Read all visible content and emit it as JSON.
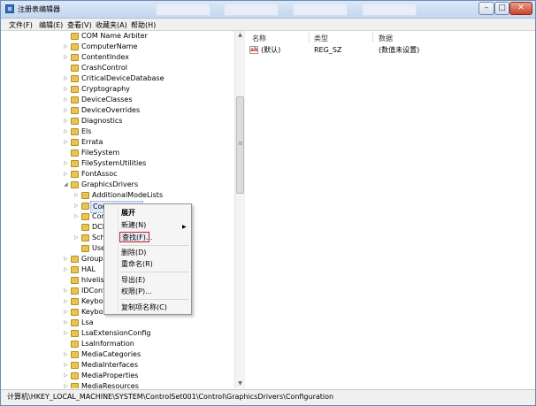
{
  "window": {
    "title": "注册表编辑器",
    "controls": {
      "minimize": "–",
      "maximize": "□",
      "close": "✕"
    }
  },
  "menubar": [
    "文件(F)",
    "编辑(E)",
    "查看(V)",
    "收藏夹(A)",
    "帮助(H)"
  ],
  "tree": {
    "items": [
      {
        "label": "COM Name Arbiter",
        "expander": ""
      },
      {
        "label": "ComputerName",
        "expander": "▷"
      },
      {
        "label": "ContentIndex",
        "expander": "▷"
      },
      {
        "label": "CrashControl",
        "expander": ""
      },
      {
        "label": "CriticalDeviceDatabase",
        "expander": "▷"
      },
      {
        "label": "Cryptography",
        "expander": "▷"
      },
      {
        "label": "DeviceClasses",
        "expander": "▷"
      },
      {
        "label": "DeviceOverrides",
        "expander": "▷"
      },
      {
        "label": "Diagnostics",
        "expander": "▷"
      },
      {
        "label": "Els",
        "expander": "▷"
      },
      {
        "label": "Errata",
        "expander": "▷"
      },
      {
        "label": "FileSystem",
        "expander": ""
      },
      {
        "label": "FileSystemUtilities",
        "expander": "▷"
      },
      {
        "label": "FontAssoc",
        "expander": "▷"
      },
      {
        "label": "GraphicsDrivers",
        "expander": "◢"
      },
      {
        "label": "AdditionalModeLists",
        "expander": "▷"
      },
      {
        "label": "Configuration",
        "expander": "▷"
      },
      {
        "label": "Con",
        "expander": "▷"
      },
      {
        "label": "DCI",
        "expander": ""
      },
      {
        "label": "Sch",
        "expander": "▷"
      },
      {
        "label": "Use",
        "expander": ""
      },
      {
        "label": "Group",
        "expander": "▷"
      },
      {
        "label": "HAL",
        "expander": "▷"
      },
      {
        "label": "hivelist",
        "expander": ""
      },
      {
        "label": "IDConf",
        "expander": "▷"
      },
      {
        "label": "Keybo",
        "expander": "▷"
      },
      {
        "label": "Keybo",
        "expander": "▷"
      },
      {
        "label": "Lsa",
        "expander": "▷"
      },
      {
        "label": "LsaExtensionConfig",
        "expander": "▷"
      },
      {
        "label": "LsaInformation",
        "expander": ""
      },
      {
        "label": "MediaCategories",
        "expander": "▷"
      },
      {
        "label": "MediaInterfaces",
        "expander": "▷"
      },
      {
        "label": "MediaProperties",
        "expander": "▷"
      },
      {
        "label": "MediaResources",
        "expander": "▷"
      }
    ]
  },
  "values": {
    "headers": {
      "name": "名称",
      "type": "类型",
      "data": "数据"
    },
    "rows": [
      {
        "icon": "ab",
        "name": "(默认)",
        "type": "REG_SZ",
        "data": "(数值未设置)"
      }
    ]
  },
  "context_menu": {
    "items": [
      {
        "label": "展开"
      },
      {
        "label": "新建(N)",
        "arrow": "▶"
      },
      {
        "label": "查找(F)..."
      },
      {
        "label": "删除(D)"
      },
      {
        "label": "重命名(R)"
      },
      {
        "label": "导出(E)"
      },
      {
        "label": "权限(P)..."
      },
      {
        "label": "复制项名称(C)"
      }
    ]
  },
  "statusbar": {
    "path": "计算机\\HKEY_LOCAL_MACHINE\\SYSTEM\\ControlSet001\\Control\\GraphicsDrivers\\Configuration"
  },
  "colors": {
    "folder": "#e7c453",
    "highlight_border": "#d01a1a",
    "titlebar": "#c3d7ef"
  }
}
